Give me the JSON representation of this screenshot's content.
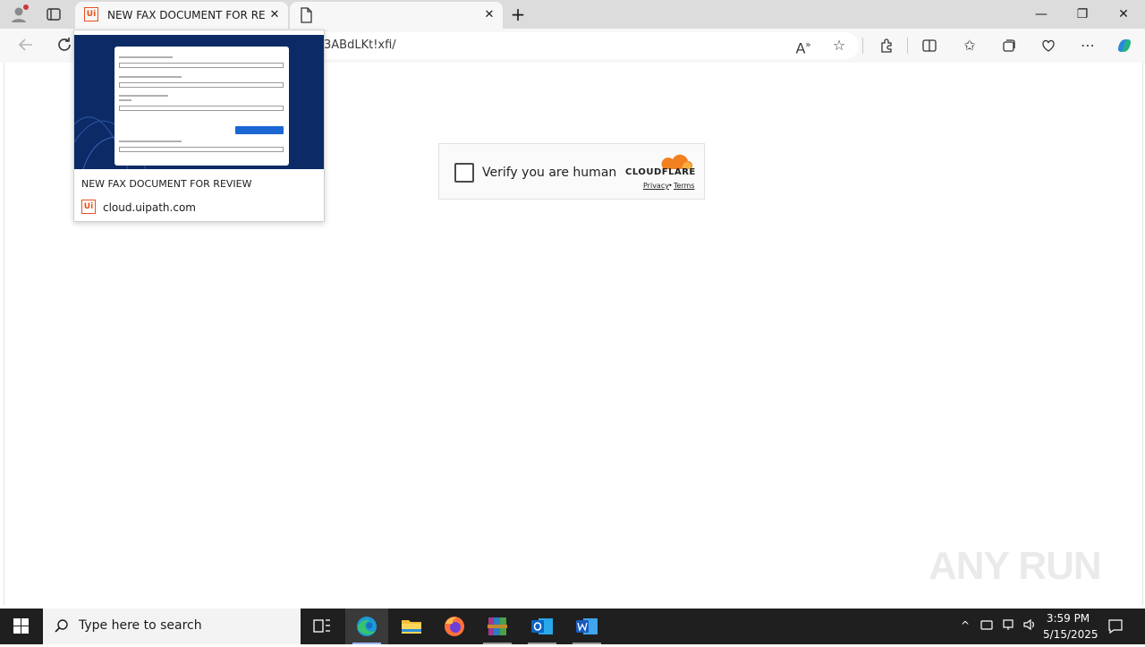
{
  "browser": {
    "tabs": [
      {
        "title": "NEW FAX DOCUMENT FOR REVIE",
        "favicon": "uipath-logo",
        "active": true
      },
      {
        "title": "",
        "favicon": "page-icon",
        "active": false
      }
    ],
    "new_tab_symbol": "+",
    "address": {
      "url_visible": "3ABdLKt!xfi/"
    },
    "window_controls": {
      "minimize": "—",
      "restore": "❐",
      "close": "✕"
    }
  },
  "hover_card": {
    "title": "NEW FAX DOCUMENT FOR REVIEW",
    "domain": "cloud.uipath.com",
    "logo_text": "Ui"
  },
  "turnstile": {
    "label": "Verify you are human",
    "brand": "CLOUDFLARE",
    "privacy": "Privacy",
    "separator": "•",
    "terms": "Terms"
  },
  "watermark": {
    "text": "ANY RUN"
  },
  "taskbar": {
    "search_placeholder": "Type here to search",
    "apps": [
      "task-view",
      "edge",
      "file-explorer",
      "firefox",
      "winrar",
      "outlook",
      "word"
    ],
    "clock": {
      "time": "3:59 PM",
      "date": "5/15/2025"
    }
  },
  "colors": {
    "tab_strip": "#dcdcdc",
    "toolbar": "#f7f7f7",
    "uipath_orange": "#e8501e",
    "cloudflare_orange": "#f38020",
    "taskbar": "#1f1f1f"
  }
}
